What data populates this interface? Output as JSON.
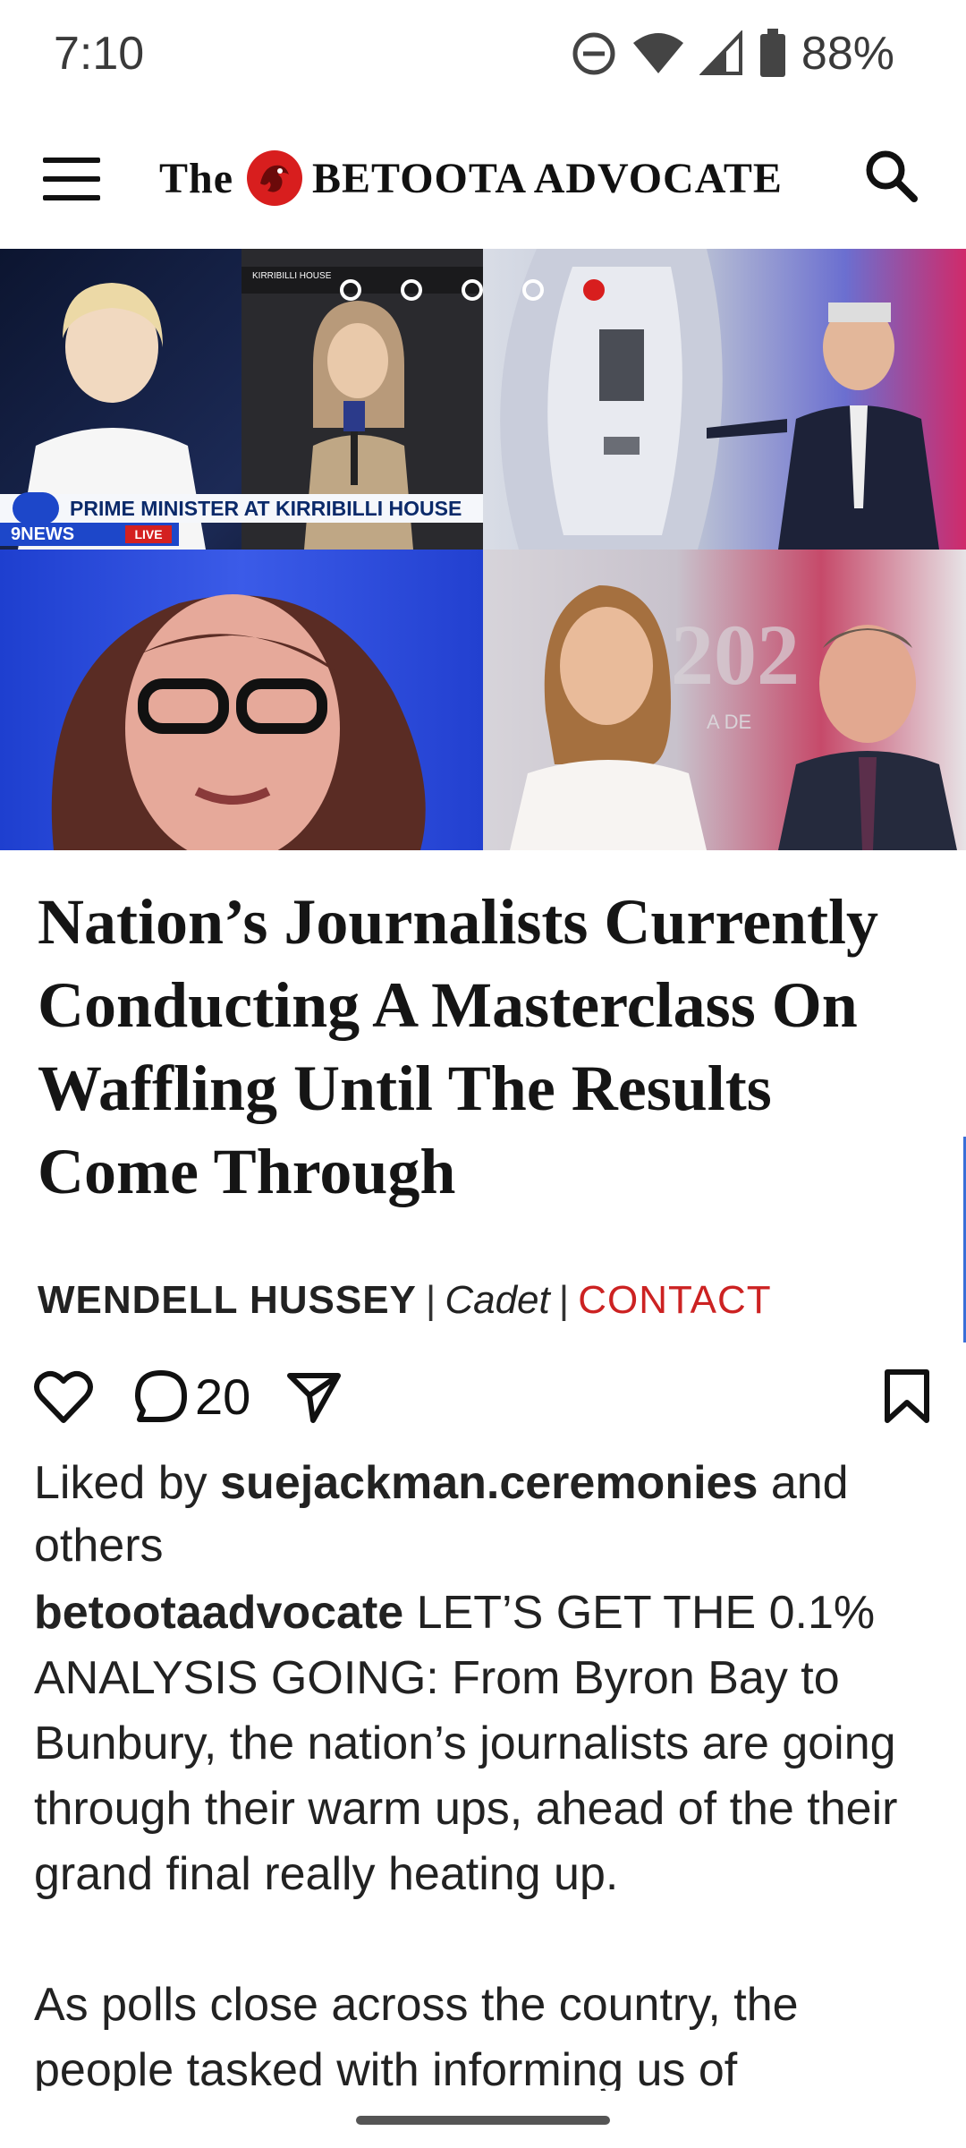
{
  "status_bar": {
    "time": "7:10",
    "battery_text": "88%",
    "icons": [
      "do-not-disturb-icon",
      "wifi-icon",
      "signal-icon",
      "battery-icon"
    ]
  },
  "header": {
    "logo_the": "The",
    "logo_name": "BETOOTA ADVOCATE",
    "menu_icon": "hamburger-menu-icon",
    "search_icon": "search-icon",
    "accent_color": "#d81e1e"
  },
  "hero": {
    "carousel_dots": 5,
    "active_dot": 5,
    "tv_graphic": {
      "location_tag": "KIRRIBILLI HOUSE",
      "ticker_text": "PRIME MINISTER AT KIRRIBILLI HOUSE",
      "network_text": "9NEWS",
      "live_text": "LIVE"
    },
    "panel4_bg_text": "202",
    "panel4_bg_sub": "A DE"
  },
  "article": {
    "headline": "Nation’s Journalists Currently Conducting A Masterclass On Waffling Until The Results Come Through",
    "byline": {
      "author": "WENDELL HUSSEY",
      "separator": "|",
      "role": "Cadet",
      "contact": "CONTACT"
    },
    "actions": {
      "comment_count": "20"
    },
    "liked": {
      "prefix": "Liked by ",
      "user": "suejackman.ceremonies",
      "suffix": " and others"
    },
    "caption": {
      "account": "betootaadvocate",
      "text": " LET’S GET THE 0.1% ANALYSIS GOING: From Byron Bay to Bunbury, the nation’s journalists are going through their warm ups, ahead of the their grand final really heating up."
    },
    "paragraph2": "As polls close across the country, the people tasked with informing us of"
  }
}
